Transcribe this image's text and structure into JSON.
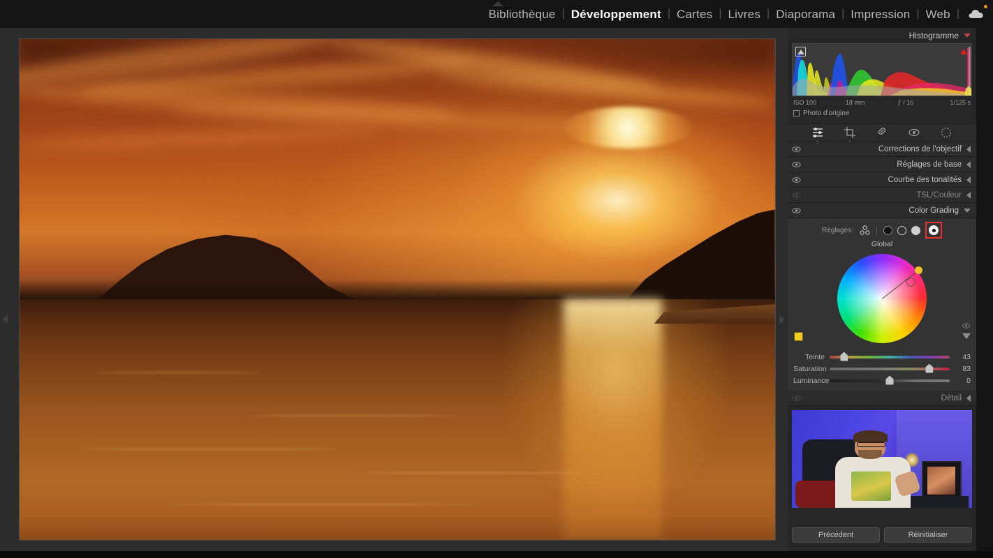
{
  "topbar": {
    "modules": [
      {
        "label": "Bibliothèque",
        "active": false
      },
      {
        "label": "Développement",
        "active": true
      },
      {
        "label": "Cartes",
        "active": false
      },
      {
        "label": "Livres",
        "active": false
      },
      {
        "label": "Diaporama",
        "active": false
      },
      {
        "label": "Impression",
        "active": false
      },
      {
        "label": "Web",
        "active": false
      }
    ],
    "separator": "|",
    "cloud_icon": "cloud-icon"
  },
  "histogram": {
    "title": "Histogramme",
    "iso": "ISO 100",
    "focal": "18 mm",
    "aperture": "ƒ / 16",
    "shutter": "1/125 s",
    "original_photo_label": "Photo d'origine",
    "clip_left_icon": "shadow-clipping-icon",
    "clip_right_icon": "highlight-clipping-icon",
    "collapse_icon": "chevron-down-icon"
  },
  "toolstrip": {
    "tools": [
      {
        "name": "masking-icon",
        "active": true,
        "has_dot": true
      },
      {
        "name": "crop-icon",
        "active": false,
        "has_dot": true
      },
      {
        "name": "healing-brush-icon",
        "active": false,
        "has_dot": false
      },
      {
        "name": "redeye-icon",
        "active": false,
        "has_dot": false
      },
      {
        "name": "radial-filter-icon",
        "active": false,
        "has_dot": false
      }
    ]
  },
  "sections": [
    {
      "label": "Corrections de l'objectif",
      "expanded": false,
      "dim": false,
      "state_icon": "chevron-left-icon"
    },
    {
      "label": "Réglages de base",
      "expanded": false,
      "dim": false,
      "state_icon": "chevron-left-icon"
    },
    {
      "label": "Courbe des tonalités",
      "expanded": false,
      "dim": false,
      "state_icon": "chevron-left-icon"
    },
    {
      "label": "TSL",
      "label_suffix": "/Couleur",
      "expanded": false,
      "dim": true,
      "state_icon": "chevron-left-icon"
    },
    {
      "label": "Color Grading",
      "expanded": true,
      "dim": false,
      "state_icon": "chevron-down-icon"
    }
  ],
  "color_grading": {
    "settings_label": "Réglages:",
    "swatches": [
      {
        "name": "three-way-view-button",
        "selected": false
      },
      {
        "name": "shadows-view-button",
        "selected": false
      },
      {
        "name": "midtones-view-button",
        "selected": false
      },
      {
        "name": "highlights-view-button",
        "selected": false
      },
      {
        "name": "global-view-button",
        "selected": true
      }
    ],
    "mode_label": "Global",
    "wheel_icon": "color-wheel",
    "eye_icon": "eyedropper-icon",
    "expand_icon": "triangle-down-icon",
    "color_swatch": "#f2d022",
    "sliders": [
      {
        "label": "Teinte",
        "value": 43,
        "percent": 12,
        "track": "hue"
      },
      {
        "label": "Saturation",
        "value": 83,
        "percent": 83,
        "track": "saturation"
      },
      {
        "label": "Luminance",
        "value": 0,
        "percent": 50,
        "track": "luminance"
      }
    ]
  },
  "detail_section": {
    "label": "Détail",
    "state_icon": "chevron-left-icon"
  },
  "buttons": {
    "previous": "Précédent",
    "reset": "Réinitialiser"
  },
  "panel_arrows": {
    "left": "show-left-panel-arrow",
    "right": "show-right-panel-arrow",
    "top": "show-top-panel-arrow",
    "bottom": "show-filmstrip-arrow"
  },
  "colors": {
    "accent_red": "#ee2d2d",
    "panel_bg": "#262626",
    "canvas_bg": "#2c2c2c",
    "swatch_yellow": "#f2d022"
  }
}
